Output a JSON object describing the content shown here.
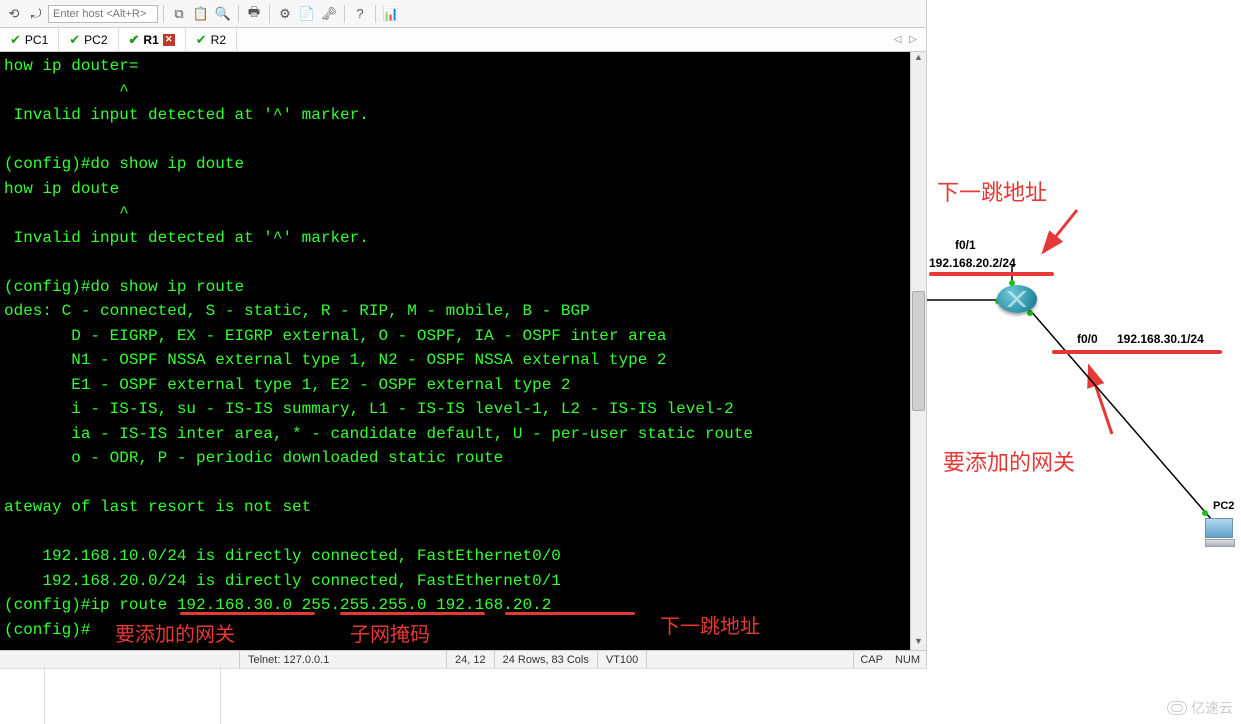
{
  "toolbar": {
    "host_placeholder": "Enter host <Alt+R>",
    "icons": {
      "reconnect": "⟲",
      "refresh": "⤾",
      "copy": "⧉",
      "paste": "📋",
      "find": "🔍",
      "print": "🖶",
      "settings": "⚙",
      "script": "📄",
      "keys": "🗝",
      "help": "?",
      "chart": "📊"
    }
  },
  "tabs": {
    "items": [
      {
        "label": "PC1",
        "active": false,
        "closable": false
      },
      {
        "label": "PC2",
        "active": false,
        "closable": false
      },
      {
        "label": "R1",
        "active": true,
        "closable": true
      },
      {
        "label": "R2",
        "active": false,
        "closable": false
      }
    ],
    "left_arrow": "◁",
    "right_arrow": "▷"
  },
  "terminal_lines": [
    "how ip douter=",
    "            ^",
    " Invalid input detected at '^' marker.",
    "",
    "(config)#do show ip doute",
    "how ip doute",
    "            ^",
    " Invalid input detected at '^' marker.",
    "",
    "(config)#do show ip route",
    "odes: C - connected, S - static, R - RIP, M - mobile, B - BGP",
    "       D - EIGRP, EX - EIGRP external, O - OSPF, IA - OSPF inter area",
    "       N1 - OSPF NSSA external type 1, N2 - OSPF NSSA external type 2",
    "       E1 - OSPF external type 1, E2 - OSPF external type 2",
    "       i - IS-IS, su - IS-IS summary, L1 - IS-IS level-1, L2 - IS-IS level-2",
    "       ia - IS-IS inter area, * - candidate default, U - per-user static route",
    "       o - ODR, P - periodic downloaded static route",
    "",
    "ateway of last resort is not set",
    "",
    "    192.168.10.0/24 is directly connected, FastEthernet0/0",
    "    192.168.20.0/24 is directly connected, FastEthernet0/1",
    "(config)#ip route 192.168.30.0 255.255.255.0 192.168.20.2",
    "(config)#"
  ],
  "term_annotations": {
    "gateway_to_add": "要添加的网关",
    "subnet_mask": "子网掩码",
    "next_hop": "下一跳地址"
  },
  "status": {
    "left_blank": "",
    "conn": "Telnet:  127.0.0.1",
    "cursor": "24,  12",
    "size": "24 Rows, 83 Cols",
    "emu": "VT100",
    "cap": "CAP",
    "num": "NUM"
  },
  "topology": {
    "top_label": "下一跳地址",
    "bottom_label": "要添加的网关",
    "iface_top": "f0/1",
    "net_top": "192.168.20.2/24",
    "iface_bottom": "f0/0",
    "net_bottom": "192.168.30.1/24",
    "pc_label": "PC2"
  },
  "watermark": "亿速云"
}
